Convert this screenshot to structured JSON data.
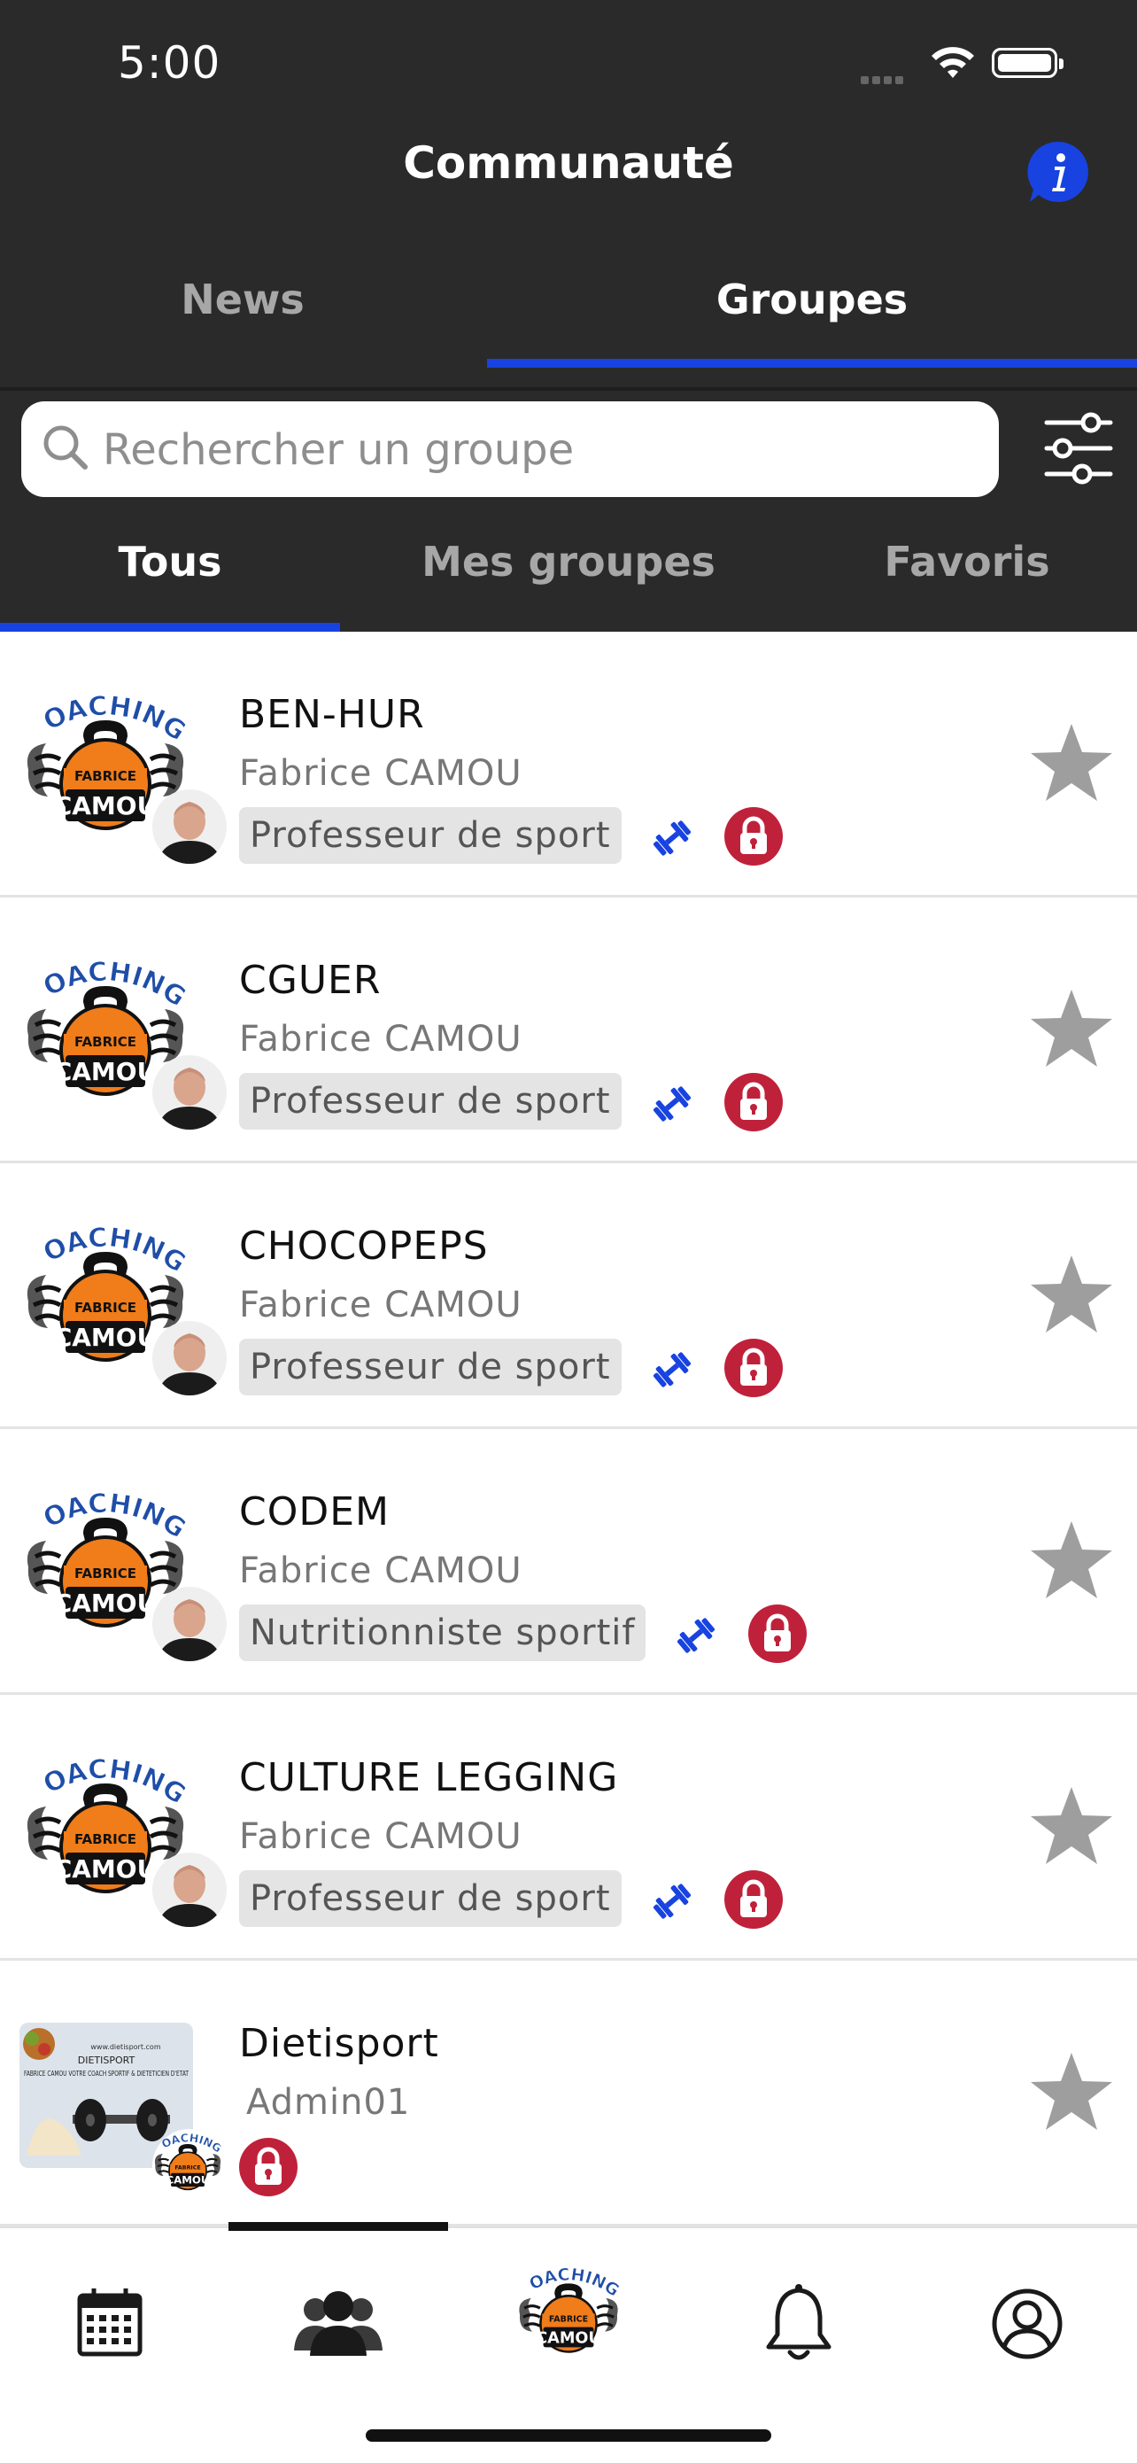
{
  "status_bar": {
    "time": "5:00"
  },
  "header": {
    "title": "Communauté",
    "info_icon": "info-icon"
  },
  "top_tabs": [
    {
      "label": "News",
      "active": false
    },
    {
      "label": "Groupes",
      "active": true
    }
  ],
  "search": {
    "placeholder": "Rechercher un groupe",
    "value": ""
  },
  "sub_tabs": [
    {
      "label": "Tous",
      "active": true
    },
    {
      "label": "Mes groupes",
      "active": false
    },
    {
      "label": "Favoris",
      "active": false
    }
  ],
  "groups": [
    {
      "name": "BEN-HUR",
      "owner": "Fabrice CAMOU",
      "badge": "Professeur de sport",
      "locked": true,
      "favorite": false
    },
    {
      "name": "CGUER",
      "owner": "Fabrice CAMOU",
      "badge": "Professeur de sport",
      "locked": true,
      "favorite": false
    },
    {
      "name": "CHOCOPEPS",
      "owner": "Fabrice CAMOU",
      "badge": "Professeur de sport",
      "locked": true,
      "favorite": false
    },
    {
      "name": "CODEM",
      "owner": "Fabrice CAMOU",
      "badge": "Nutritionniste sportif",
      "locked": true,
      "favorite": false
    },
    {
      "name": "CULTURE LEGGING",
      "owner": "Fabrice CAMOU",
      "badge": "Professeur de sport",
      "locked": true,
      "favorite": false
    },
    {
      "name": "Dietisport",
      "owner": "Admin01",
      "badge": "",
      "locked": true,
      "favorite": false
    }
  ],
  "logo": {
    "line1": "COACHING",
    "line2": "FABRICE",
    "line3": "CAMOU"
  },
  "dietisport_image": {
    "url_text": "www.dietisport.com",
    "brand": "DIETISPORT",
    "tagline": "FABRICE CAMOU VOTRE COACH SPORTIF & DIETETICIEN D'ETAT"
  },
  "bottom_nav": [
    {
      "name": "calendar-icon"
    },
    {
      "name": "community-icon",
      "active": true
    },
    {
      "name": "coaching-logo-icon"
    },
    {
      "name": "bell-icon"
    },
    {
      "name": "profile-icon"
    }
  ],
  "colors": {
    "header_bg": "#2a2a2a",
    "accent_blue": "#1843e0",
    "lock_red": "#c0213a",
    "star_gray": "#9e9e9e",
    "logo_orange": "#f07c1a",
    "logo_blue": "#1f4ea8"
  }
}
